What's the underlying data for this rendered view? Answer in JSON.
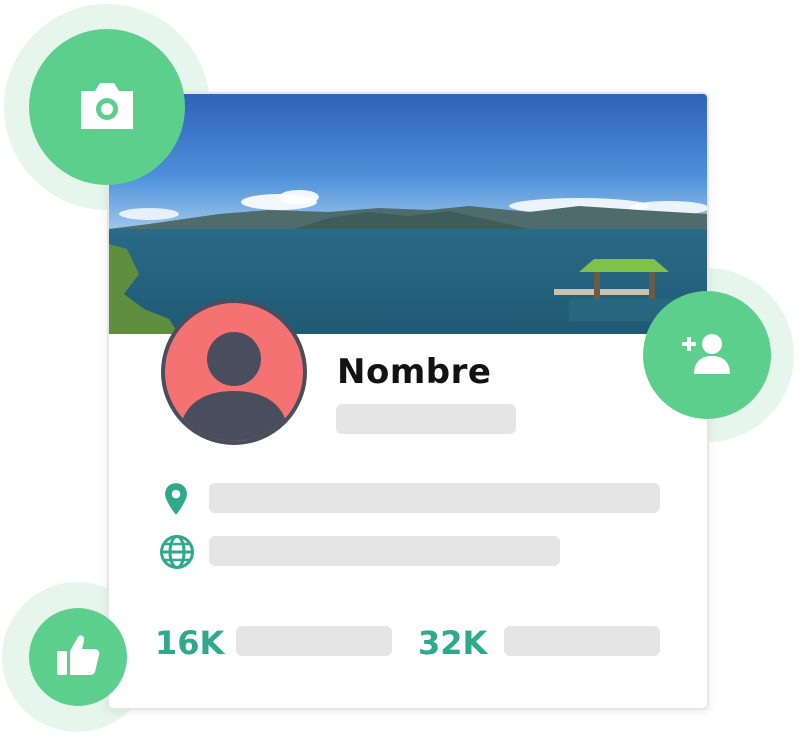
{
  "profile": {
    "name": "Nombre"
  },
  "stats": {
    "first_value": "16K",
    "second_value": "32K"
  },
  "colors": {
    "accent_green": "#5ccf8c",
    "stat_green": "#2ea98a",
    "avatar_bg": "#f47272",
    "placeholder": "#e5e5e5"
  },
  "icons": {
    "camera": "camera-icon",
    "add_user": "add-user-icon",
    "like": "thumbs-up-icon",
    "location": "location-pin-icon",
    "website": "globe-icon"
  }
}
